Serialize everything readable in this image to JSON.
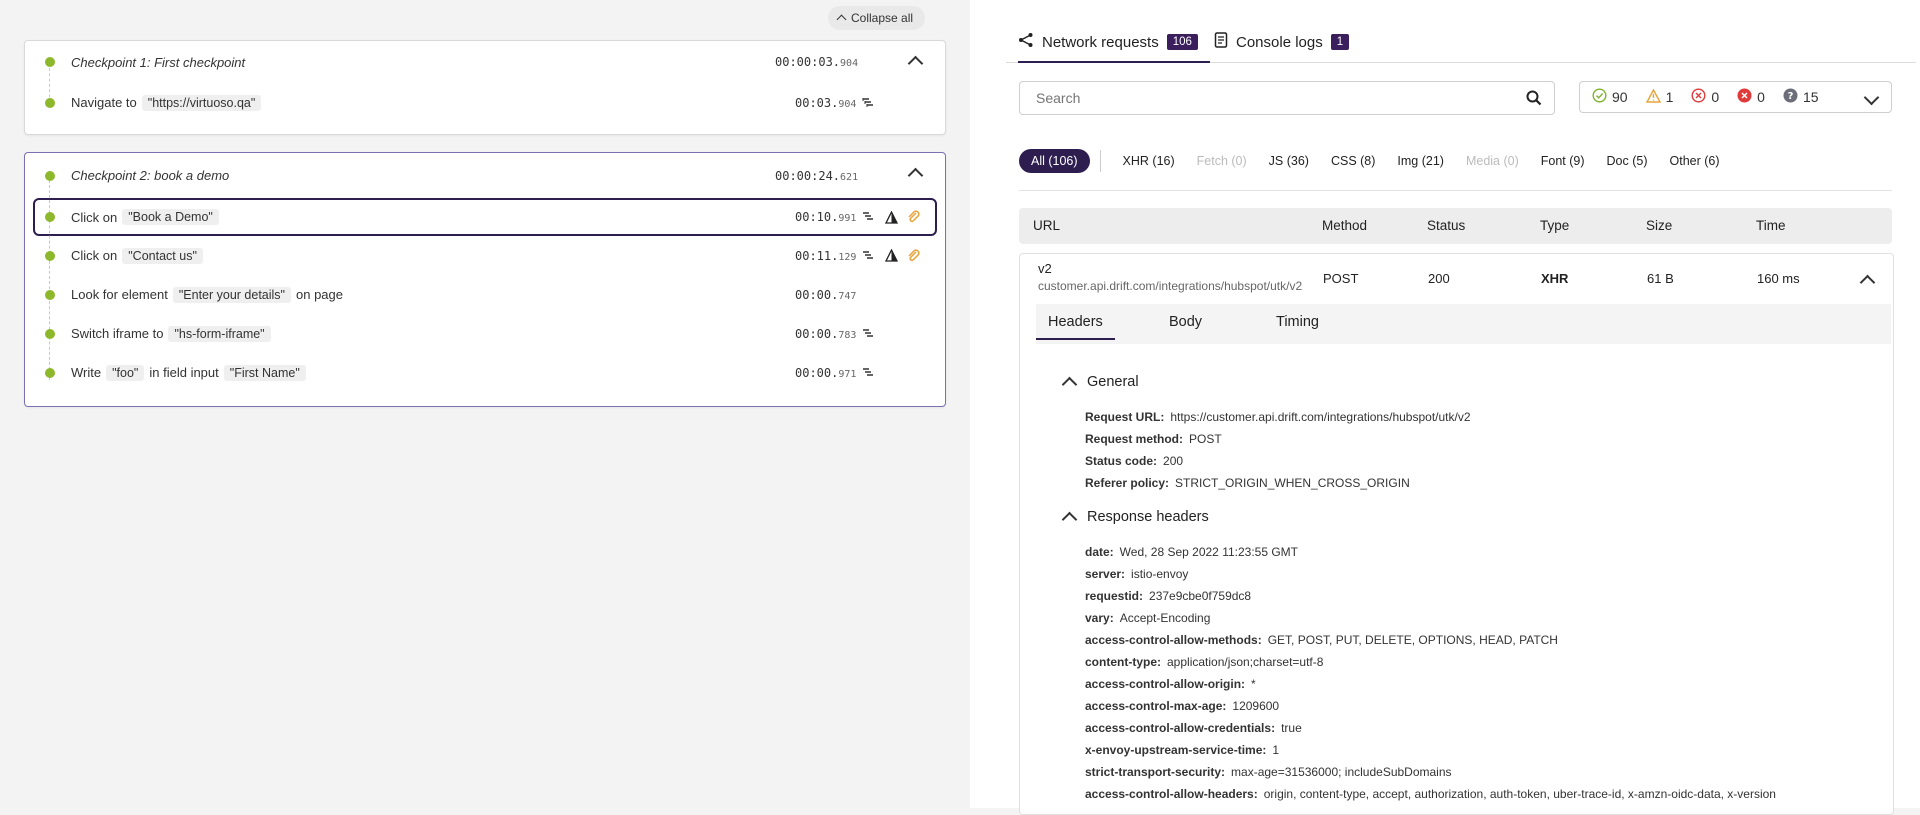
{
  "collapse_all": "Collapse all",
  "checkpoints": [
    {
      "title": "Checkpoint 1: First checkpoint",
      "time_main": "00:00:03.",
      "time_ms": "904",
      "steps": [
        {
          "pre": "Navigate to",
          "chip1": "\"https://virtuoso.qa\"",
          "mid": "",
          "chip2": "",
          "post": "",
          "time_main": "00:03.",
          "time_ms": "904"
        }
      ]
    },
    {
      "title": "Checkpoint 2: book a demo",
      "time_main": "00:00:24.",
      "time_ms": "621",
      "steps": [
        {
          "pre": "Click on",
          "chip1": "\"Book a Demo\"",
          "time_main": "00:10.",
          "time_ms": "991"
        },
        {
          "pre": "Click on",
          "chip1": "\"Contact us\"",
          "time_main": "00:11.",
          "time_ms": "129"
        },
        {
          "pre": "Look for element",
          "chip1": "\"Enter your details\"",
          "post": "on page",
          "time_main": "00:00.",
          "time_ms": "747"
        },
        {
          "pre": "Switch iframe to",
          "chip1": "\"hs-form-iframe\"",
          "time_main": "00:00.",
          "time_ms": "783"
        },
        {
          "pre": "Write",
          "chip1": "\"foo\"",
          "mid": "in field input",
          "chip2": "\"First Name\"",
          "time_main": "00:00.",
          "time_ms": "971"
        }
      ]
    }
  ],
  "tabs": {
    "network": {
      "label": "Network requests",
      "count": "106"
    },
    "console": {
      "label": "Console logs",
      "count": "1"
    }
  },
  "search": {
    "placeholder": "Search"
  },
  "status_summary": {
    "ok": "90",
    "warn": "1",
    "err_outline": "0",
    "err_filled": "0",
    "unknown": "15"
  },
  "filters": [
    {
      "label": "All (106)",
      "state": "active"
    },
    {
      "label": "XHR (16)",
      "state": "normal"
    },
    {
      "label": "Fetch (0)",
      "state": "disabled"
    },
    {
      "label": "JS (36)",
      "state": "normal"
    },
    {
      "label": "CSS (8)",
      "state": "normal"
    },
    {
      "label": "Img (21)",
      "state": "normal"
    },
    {
      "label": "Media (0)",
      "state": "disabled"
    },
    {
      "label": "Font (9)",
      "state": "normal"
    },
    {
      "label": "Doc (5)",
      "state": "normal"
    },
    {
      "label": "Other (6)",
      "state": "normal"
    }
  ],
  "table": {
    "headers": {
      "url": "URL",
      "method": "Method",
      "status": "Status",
      "type": "Type",
      "size": "Size",
      "time": "Time"
    },
    "row": {
      "name": "v2",
      "host": "customer.api.drift.com/integrations/hubspot/utk/v2",
      "method": "POST",
      "status": "200",
      "type": "XHR",
      "size": "61 B",
      "time": "160 ms"
    }
  },
  "detail_tabs": {
    "headers": "Headers",
    "body": "Body",
    "timing": "Timing"
  },
  "general": {
    "title": "General",
    "items": [
      {
        "k": "Request URL:",
        "v": "https://customer.api.drift.com/integrations/hubspot/utk/v2"
      },
      {
        "k": "Request method:",
        "v": "POST"
      },
      {
        "k": "Status code:",
        "v": "200"
      },
      {
        "k": "Referer policy:",
        "v": "STRICT_ORIGIN_WHEN_CROSS_ORIGIN"
      }
    ]
  },
  "response_headers": {
    "title": "Response headers",
    "items": [
      {
        "k": "date:",
        "v": "Wed, 28 Sep 2022 11:23:55 GMT"
      },
      {
        "k": "server:",
        "v": "istio-envoy"
      },
      {
        "k": "requestid:",
        "v": "237e9cbe0f759dc8"
      },
      {
        "k": "vary:",
        "v": "Accept-Encoding"
      },
      {
        "k": "access-control-allow-methods:",
        "v": "GET, POST, PUT, DELETE, OPTIONS, HEAD, PATCH"
      },
      {
        "k": "content-type:",
        "v": "application/json;charset=utf-8"
      },
      {
        "k": "access-control-allow-origin:",
        "v": "*"
      },
      {
        "k": "access-control-max-age:",
        "v": "1209600"
      },
      {
        "k": "access-control-allow-credentials:",
        "v": "true"
      },
      {
        "k": "x-envoy-upstream-service-time:",
        "v": "1"
      },
      {
        "k": "strict-transport-security:",
        "v": "max-age=31536000; includeSubDomains"
      },
      {
        "k": "access-control-allow-headers:",
        "v": "origin, content-type, accept, authorization, auth-token, uber-trace-id, x-amzn-oidc-data, x-version"
      }
    ]
  }
}
